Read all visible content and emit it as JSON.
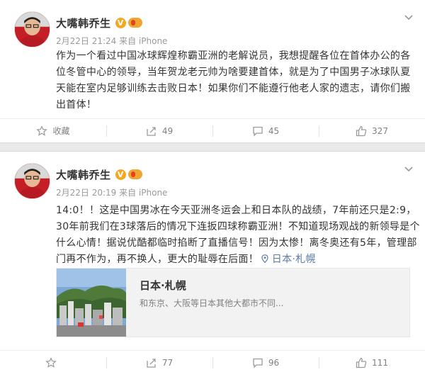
{
  "posts": [
    {
      "author": "大嘴韩乔生",
      "verified_badge": "V",
      "meta": "2月22日 21:24 来自 iPhone",
      "content_lines": [
        "作为一个看过中国冰球辉煌称霸亚洲的老解说员，我想提醒各位在首体办公的各",
        "位冬管中心的领导，当年贺龙老元帅为啥要建首体，就是为了中国男子冰球队夏",
        "天能在室内足够训练去击败日本！如果你们不能遵行他老人家的遗志，请你们搬",
        "出首体！"
      ],
      "actions": {
        "favorite": "收藏",
        "repost": "49",
        "comment": "45",
        "like": "327"
      }
    },
    {
      "author": "大嘴韩乔生",
      "verified_badge": "V",
      "meta": "2月22日 20:19 来自 iPhone",
      "content_lines": [
        "14:0！！这是中国男冰在今天亚洲冬运会上和日本队的战绩，7年前还只是2:9，",
        "30年前我们在3球落后的情况下连扳四球称霸亚洲！不知道现场观战的新领导是个",
        "什么心情！据说优酷都临时掐断了直播信号！因为太惨！离冬奥还有5年，管理部",
        "门再不作为，再不换人，更大的耻辱在后面！"
      ],
      "location": "日本·札幌",
      "card": {
        "title": "日本·札幌",
        "desc": "和东京、大阪等日本其他大都市不同..."
      },
      "actions": {
        "favorite": "",
        "repost": "77",
        "comment": "96",
        "like": "111"
      }
    }
  ],
  "icons": {
    "favorite": "star-icon",
    "repost": "share-arrow-icon",
    "comment": "comment-bubble-icon",
    "like": "thumbs-up-icon",
    "menu": "chevron-down-icon",
    "location": "location-pin-icon"
  },
  "colors": {
    "link": "#5b7ba8",
    "badge": "#f5a623",
    "separator": "#e9e9e9"
  }
}
